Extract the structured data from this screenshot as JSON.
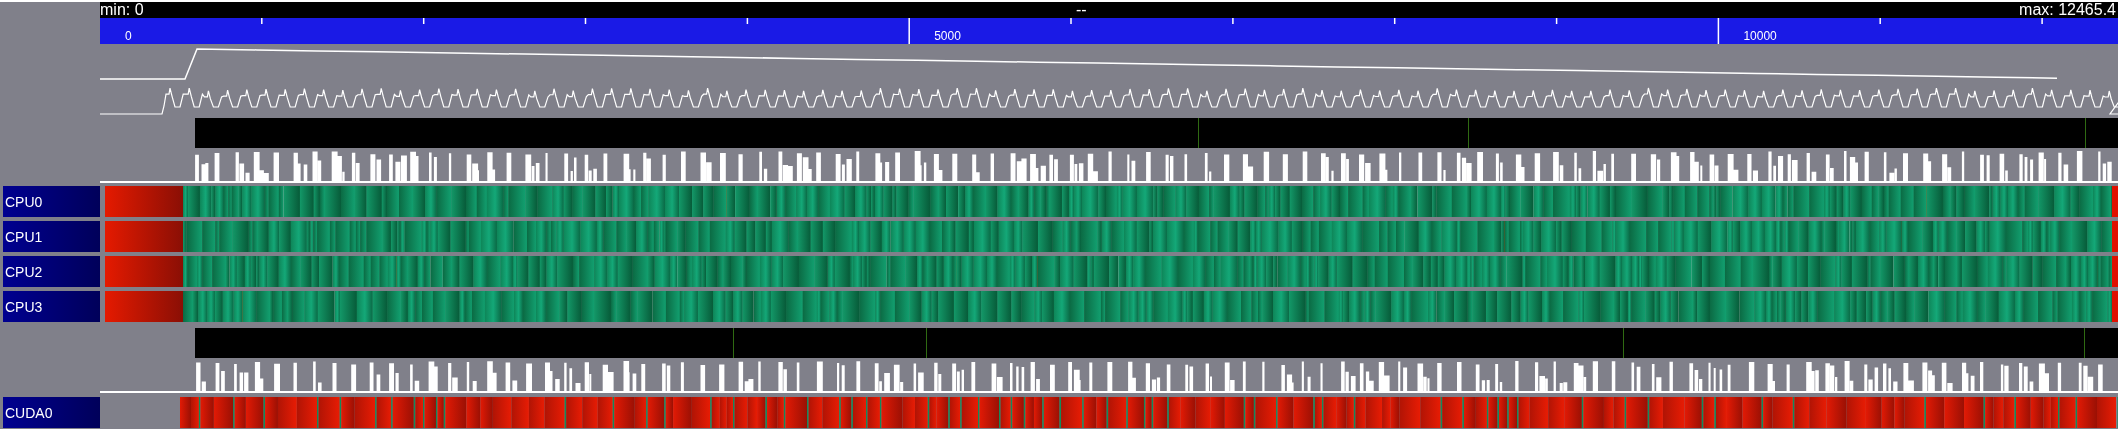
{
  "header": {
    "min_label": "min: 0",
    "center_label": "--",
    "max_label": "max: 12465.4"
  },
  "ruler": {
    "labels": [
      {
        "text": "0"
      },
      {
        "text": "5000"
      },
      {
        "text": "10000"
      }
    ]
  },
  "tracks": [
    {
      "kind": "cpu",
      "label": "CPU0"
    },
    {
      "kind": "cpu",
      "label": "CPU1"
    },
    {
      "kind": "cpu",
      "label": "CPU2"
    },
    {
      "kind": "cpu",
      "label": "CPU3"
    },
    {
      "kind": "gpu",
      "label": "CUDA0"
    }
  ]
}
